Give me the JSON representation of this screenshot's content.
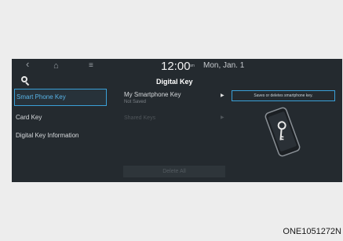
{
  "status_bar": {
    "back_icon": "back-arrow-icon",
    "home_icon": "home-icon",
    "menu_icon": "menu-icon",
    "time": "12:00",
    "ampm": "am",
    "date": "Mon, Jan. 1"
  },
  "header": {
    "search_icon": "search-icon",
    "title": "Digital Key"
  },
  "sidebar": {
    "items": [
      {
        "label": "Smart Phone Key",
        "active": true
      },
      {
        "label": "Card Key",
        "active": false
      },
      {
        "label": "Digital Key Information",
        "active": false
      }
    ]
  },
  "main": {
    "my_key_title": "My Smartphone Key",
    "my_key_status": "Not Saved",
    "my_key_arrow": "▶",
    "shared_keys_label": "Shared Keys",
    "shared_keys_arrow": "▶",
    "tooltip": "Saves or deletes smartphone key.",
    "illustration": "phone-key-icon",
    "delete_all_label": "Delete All"
  },
  "caption": "ONE1051272N",
  "colors": {
    "screen_bg": "#242a2f",
    "accent": "#3aa0d8",
    "page_bg": "#ededed"
  }
}
